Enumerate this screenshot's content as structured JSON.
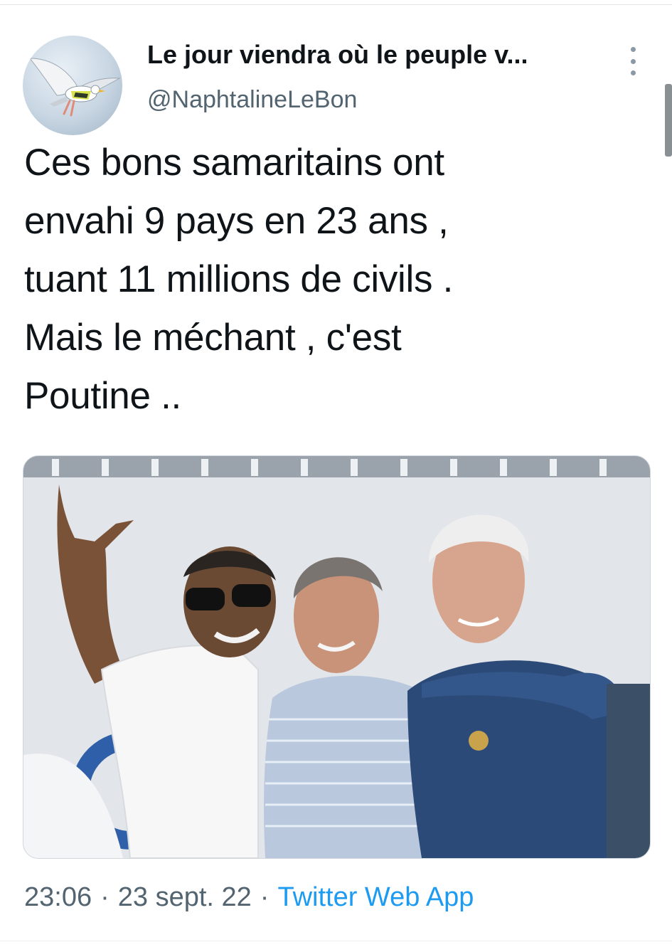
{
  "tweet": {
    "display_name": "Le jour viendra où le peuple v...",
    "handle": "@NaphtalineLeBon",
    "text": "Ces bons samaritains ont\nenvahi 9 pays en 23 ans ,\ntuant 11 millions de civils .\nMais le méchant , c'est\nPoutine ..",
    "time": "23:06",
    "date": "23 sept. 22",
    "source": "Twitter Web App",
    "separator": "·"
  },
  "icons": {
    "more": "more-vertical-icon",
    "avatar": "seagull-avatar"
  },
  "colors": {
    "text": "#0f1419",
    "secondary": "#536471",
    "link": "#1d9bf0"
  }
}
